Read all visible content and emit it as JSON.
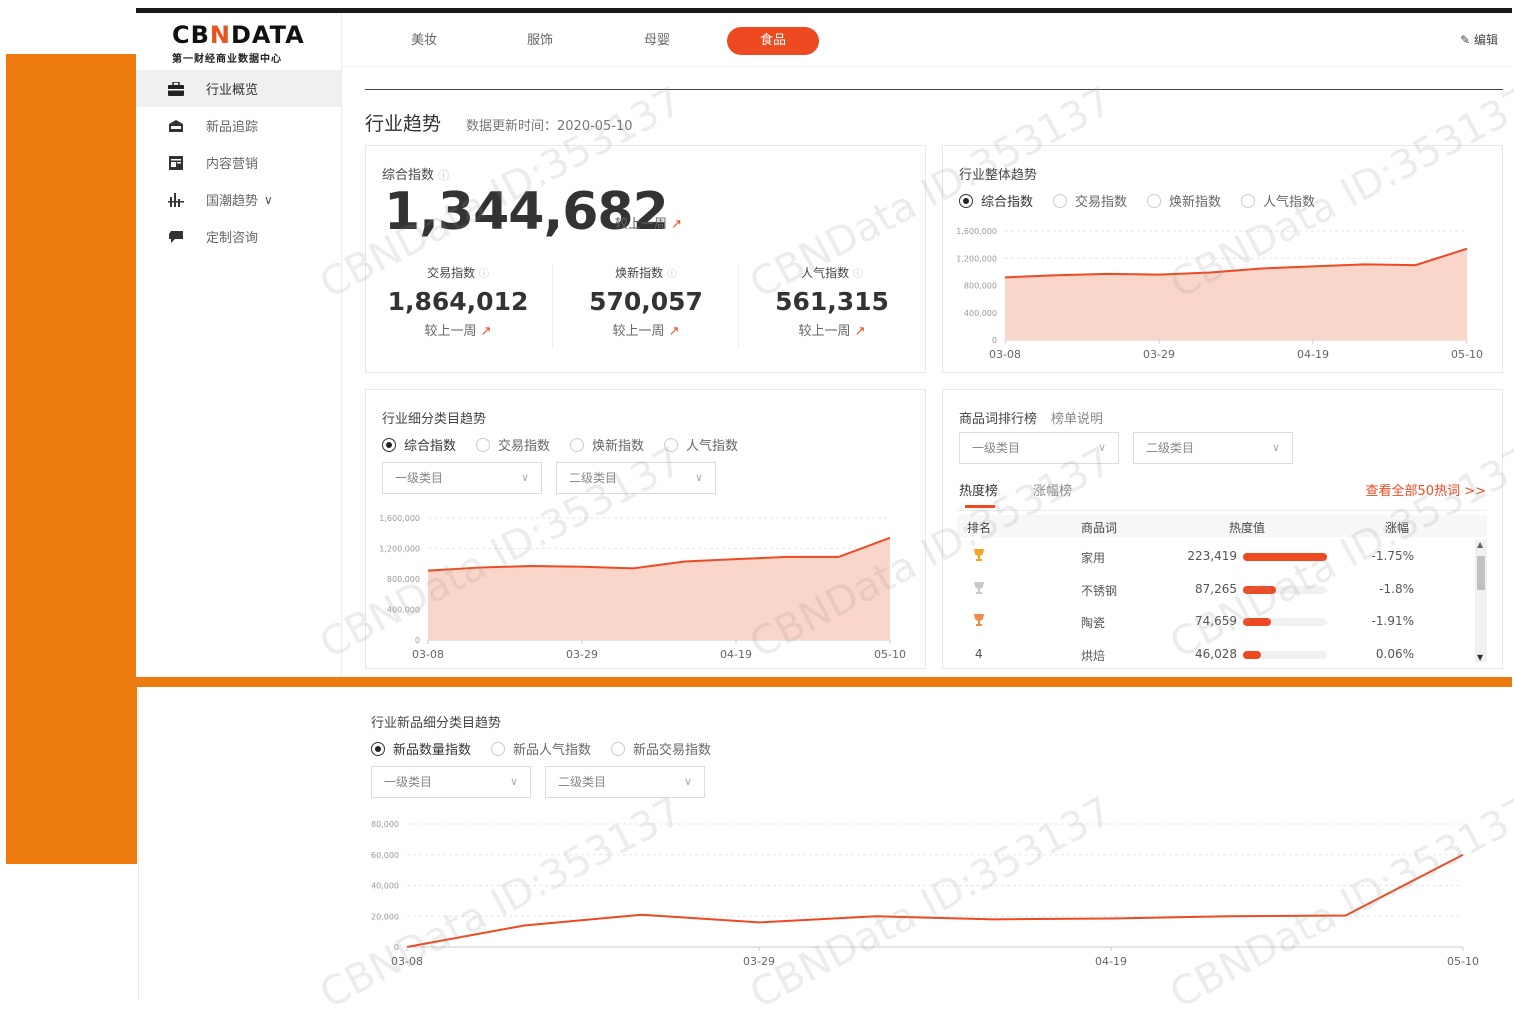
{
  "brand": {
    "name_a": "CB",
    "name_n": "N",
    "name_b": "DATA",
    "subtitle": "第一财经商业数据中心"
  },
  "nav": [
    {
      "label": "行业概览",
      "icon": "briefcase-icon"
    },
    {
      "label": "新品追踪",
      "icon": "new-badge-icon"
    },
    {
      "label": "内容营销",
      "icon": "document-icon"
    },
    {
      "label": "国潮趋势",
      "icon": "bar-icon"
    },
    {
      "label": "定制咨询",
      "icon": "chat-icon"
    }
  ],
  "nav_expand_glyph": "∨",
  "tabs": [
    "美妆",
    "服饰",
    "母婴",
    "食品"
  ],
  "active_tab": "食品",
  "edit_label": "编辑",
  "page_title": "行业趋势",
  "update_label": "数据更新时间：2020-05-10",
  "composite": {
    "title": "综合指数",
    "value": "1,344,682",
    "compare": "较上一周",
    "subs": [
      {
        "label": "交易指数",
        "value": "1,864,012",
        "compare": "较上一周"
      },
      {
        "label": "焕新指数",
        "value": "570,057",
        "compare": "较上一周"
      },
      {
        "label": "人气指数",
        "value": "561,315",
        "compare": "较上一周"
      }
    ]
  },
  "overall_trend": {
    "title": "行业整体趋势",
    "radios": [
      "综合指数",
      "交易指数",
      "焕新指数",
      "人气指数"
    ]
  },
  "sub_trend": {
    "title": "行业细分类目趋势",
    "radios": [
      "综合指数",
      "交易指数",
      "焕新指数",
      "人气指数"
    ],
    "select1": "一级类目",
    "select2": "二级类目"
  },
  "ranking": {
    "title": "商品词排行榜",
    "explain": "榜单说明",
    "select1": "一级类目",
    "select2": "二级类目",
    "tab_hot": "热度榜",
    "tab_rise": "涨幅榜",
    "view_all": "查看全部50热词 >>",
    "headers": [
      "排名",
      "商品词",
      "热度值",
      "涨幅"
    ],
    "rows": [
      {
        "rank": "",
        "rank_icon": "gold-trophy-icon",
        "word": "家用",
        "heat": "223,419",
        "pct": 1.0,
        "change": "-1.75%"
      },
      {
        "rank": "",
        "rank_icon": "silver-trophy-icon",
        "word": "不锈钢",
        "heat": "87,265",
        "pct": 0.39,
        "change": "-1.8%"
      },
      {
        "rank": "",
        "rank_icon": "bronze-trophy-icon",
        "word": "陶瓷",
        "heat": "74,659",
        "pct": 0.33,
        "change": "-1.91%"
      },
      {
        "rank": "4",
        "rank_icon": "",
        "word": "烘焙",
        "heat": "46,028",
        "pct": 0.21,
        "change": "0.06%"
      }
    ]
  },
  "new_trend": {
    "title": "行业新品细分类目趋势",
    "radios": [
      "新品数量指数",
      "新品人气指数",
      "新品交易指数"
    ],
    "select1": "一级类目",
    "select2": "二级类目"
  },
  "watermark": "CBNData ID:353137",
  "colors": {
    "accent": "#ee4a22",
    "orange": "#ed7a0e",
    "area_fill": "#f9d5ca"
  },
  "chart_data": [
    {
      "type": "area",
      "x": [
        "03-08",
        "03-15",
        "03-22",
        "03-29",
        "04-05",
        "04-12",
        "04-19",
        "04-26",
        "05-03",
        "05-10"
      ],
      "values": [
        920000,
        950000,
        970000,
        960000,
        990000,
        1050000,
        1080000,
        1110000,
        1100000,
        1340000
      ],
      "xticks": [
        "03-08",
        "03-29",
        "04-19",
        "05-10"
      ],
      "yticks": [
        "1,600,000",
        "1,200,000",
        "800,000",
        "400,000",
        "0"
      ],
      "ylim": [
        0,
        1600000
      ]
    },
    {
      "type": "area",
      "x": [
        "03-08",
        "03-15",
        "03-22",
        "03-29",
        "04-05",
        "04-12",
        "04-19",
        "04-26",
        "05-03",
        "05-10"
      ],
      "values": [
        910000,
        950000,
        970000,
        960000,
        940000,
        1030000,
        1060000,
        1090000,
        1090000,
        1340000
      ],
      "xticks": [
        "03-08",
        "03-29",
        "04-19",
        "05-10"
      ],
      "yticks": [
        "1,600,000",
        "1,200,000",
        "800,000",
        "400,000",
        "0"
      ],
      "ylim": [
        0,
        1600000
      ]
    },
    {
      "type": "line",
      "x": [
        "03-08",
        "03-15",
        "03-22",
        "03-29",
        "04-05",
        "04-12",
        "04-19",
        "04-26",
        "05-03",
        "05-10"
      ],
      "values": [
        0,
        14000,
        21000,
        16000,
        20000,
        18000,
        18500,
        20000,
        20500,
        60000
      ],
      "xticks": [
        "03-08",
        "03-29",
        "04-19",
        "05-10"
      ],
      "yticks": [
        "80,000",
        "60,000",
        "40,000",
        "20,000",
        "0"
      ],
      "ylim": [
        0,
        80000
      ]
    }
  ]
}
